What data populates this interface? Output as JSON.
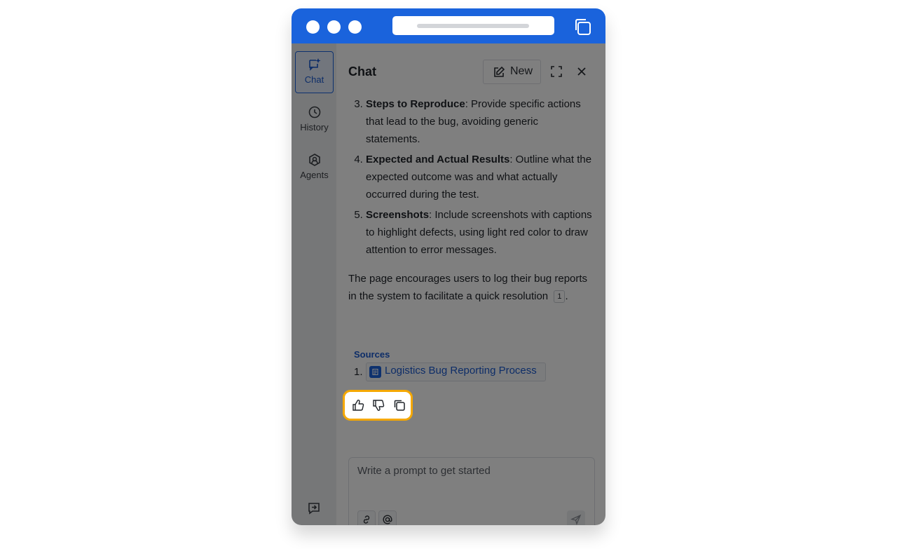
{
  "header": {
    "title": "Chat",
    "new_label": "New"
  },
  "rail": {
    "items": [
      {
        "label": "Chat",
        "icon": "chat-sparkle-icon",
        "active": true
      },
      {
        "label": "History",
        "icon": "clock-icon",
        "active": false
      },
      {
        "label": "Agents",
        "icon": "agent-hexagon-icon",
        "active": false
      }
    ]
  },
  "message": {
    "steps": [
      {
        "number": "3",
        "title": "Steps to Reproduce",
        "text": ": Provide specific actions that lead to the bug, avoiding generic statements."
      },
      {
        "number": "4",
        "title": "Expected and Actual Results",
        "text": ": Outline what the expected outcome was and what actually occurred during the test."
      },
      {
        "number": "5",
        "title": "Screenshots",
        "text": ": Include screenshots with captions to highlight defects, using light red color to draw attention to error messages."
      }
    ],
    "paragraph": "The page encourages users to log their bug reports in the system to facilitate a quick resolution",
    "citation": "1",
    "paragraph_end": "."
  },
  "sources": {
    "label": "Sources",
    "items": [
      {
        "number": "1.",
        "title": "Logistics Bug Reporting Process"
      }
    ]
  },
  "composer": {
    "placeholder": "Write a prompt to get started"
  },
  "colors": {
    "brand": "#1a63dc",
    "highlight": "#f5a800"
  }
}
